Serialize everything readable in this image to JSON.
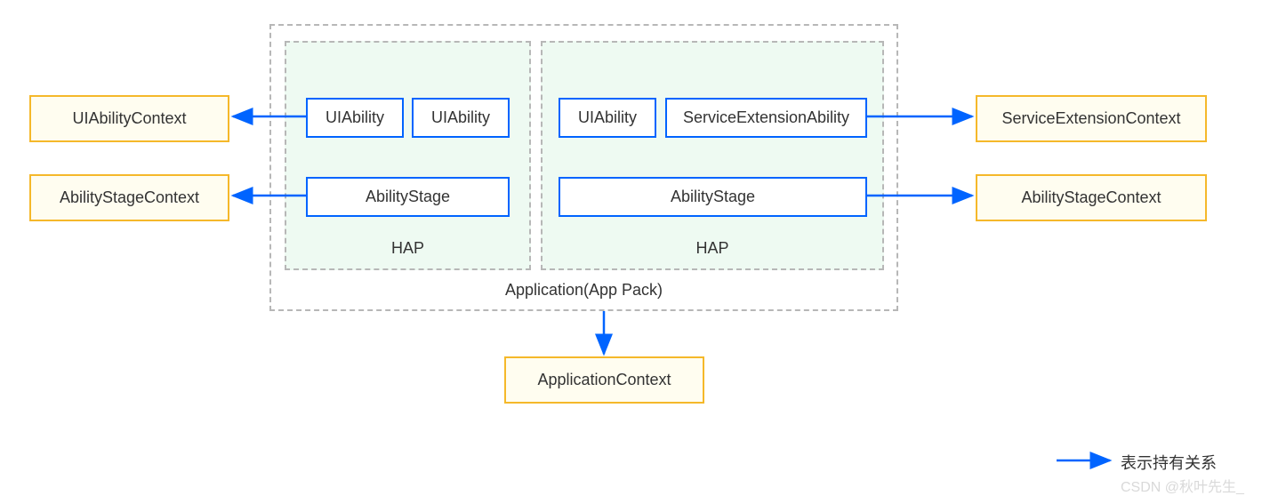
{
  "left": {
    "uiAbilityContext": "UIAbilityContext",
    "abilityStageContext": "AbilityStageContext"
  },
  "right": {
    "serviceExtensionContext": "ServiceExtensionContext",
    "abilityStageContext": "AbilityStageContext"
  },
  "app": {
    "outerLabel": "Application(App Pack)",
    "hap1": {
      "label": "HAP",
      "uiAbility1": "UIAbility",
      "uiAbility2": "UIAbility",
      "abilityStage": "AbilityStage"
    },
    "hap2": {
      "label": "HAP",
      "uiAbility": "UIAbility",
      "serviceExtensionAbility": "ServiceExtensionAbility",
      "abilityStage": "AbilityStage"
    }
  },
  "bottom": {
    "applicationContext": "ApplicationContext"
  },
  "legend": {
    "text": "表示持有关系"
  },
  "watermark": "CSDN @秋叶先生_",
  "colors": {
    "orange": "#f5b82a",
    "orangeFill": "#fffdf0",
    "blue": "#0064ff",
    "greenFill": "#eefaf2",
    "dashed": "#b7b7b7"
  }
}
